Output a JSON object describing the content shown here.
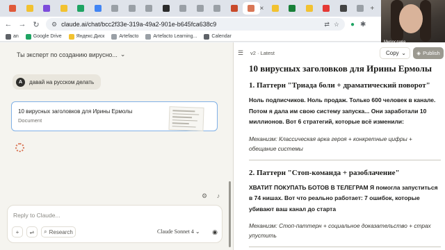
{
  "browser": {
    "active_tab_close": "×",
    "new_tab": "+",
    "url": "claude.ai/chat/bcc2f33e-319a-49a2-901e-b645fca638c9",
    "tab_favicon_colors": [
      "#e05a3a",
      "#f2c230",
      "#7d4cdb",
      "#f2c230",
      "#1fa463",
      "#4285f4",
      "#9aa0a6",
      "#9aa0a6",
      "#9aa0a6",
      "#2b2b2b",
      "#9aa0a6",
      "#9aa0a6",
      "#9aa0a6",
      "#c94a2a",
      "#d97757",
      "#f2c230",
      "#188038",
      "#f2c230",
      "#e53935",
      "#444444",
      "#9aa0a6"
    ],
    "bookmarks": [
      {
        "label": "an",
        "color": "#5f6368"
      },
      {
        "label": "Google Drive",
        "color": "#1fa463"
      },
      {
        "label": "Яндекс.Диск",
        "color": "#f2c230"
      },
      {
        "label": "Artefacto",
        "color": "#9aa0a6"
      },
      {
        "label": "Artefacto Learning...",
        "color": "#9aa0a6"
      },
      {
        "label": "Calendar",
        "color": "#5f6368"
      }
    ]
  },
  "webcam": {
    "name": "Мирослава"
  },
  "chat": {
    "title": "Ты эксперт по созданию вирусно...",
    "title_chevron": "⌄",
    "user_avatar": "A",
    "user_message": "давай на русском делать",
    "doc_title": "10 вирусных заголовков для Ирины Ермолы",
    "doc_type": "Document",
    "input_placeholder": "Reply to Claude...",
    "research_label": "Research",
    "model_label": "Claude Sonnet 4",
    "model_chevron": "⌄"
  },
  "artifact": {
    "version_label": "v2 · Latest",
    "copy_label": "Copy",
    "copy_chevron": "⌄",
    "publish_label": "Publish",
    "heading": "10 вирусных заголовков для Ирины Ермолы",
    "sections": [
      {
        "title": "1. Паттерн \"Триада боли + драматический поворот\"",
        "text": "Ноль подписчиков. Ноль продаж. Только 600 человек в канале. Потом я дала им свою систему запуска... Они заработали 10 миллионов. Вот 6 стратегий, которые всё изменили:",
        "mechanism": "Механизм: Классическая арка героя + конкретные цифры + обещание системы"
      },
      {
        "title": "2. Паттерн \"Стоп-команда + разоблачение\"",
        "text": "ХВАТИТ ПОКУПАТЬ БОТОВ В ТЕЛЕГРАМ Я помогла запуститься в 74 нишах. Вот что реально работает: 7 ошибок, которые убивают ваш канал до старта",
        "mechanism": "Механизм: Стоп-паттерн + социальное доказательство + страх упустить"
      }
    ]
  }
}
